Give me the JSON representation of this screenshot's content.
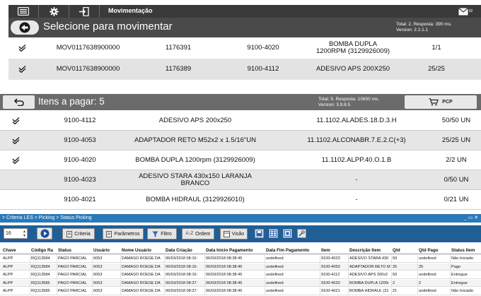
{
  "mov_screen": {
    "topbar": {
      "menu_icon": "hamburger-icon",
      "settings_icon": "gear-icon",
      "exit_icon": "exit-icon",
      "title": "Movimentação",
      "mail_icon": "envelope-icon",
      "mail_badge": "92"
    },
    "header": {
      "title": "Selecione para movimentar",
      "info_line1": "Total: 2. Resposta: 390 ms.",
      "info_line2": "Version: 2.2.1.1"
    },
    "rows": [
      {
        "mov": "MOV0117638900000",
        "code": "1176391",
        "ref": "9100-4020",
        "desc": "BOMBA DUPLA 1200RPM (3129926009)",
        "qty": "1/1"
      },
      {
        "mov": "MOV0117638900000",
        "code": "1176389",
        "ref": "9100-4112",
        "desc": "ADESIVO APS 200X250",
        "qty": "25/25"
      }
    ]
  },
  "pay_screen": {
    "header": {
      "title": "Itens a pagar: 5",
      "info_line1": "Total: 5. Resposta: 10650 ms.",
      "info_line2": "Version: 3.9.8.5",
      "pcp_label": "PCP"
    },
    "rows": [
      {
        "checked": true,
        "ref": "9100-4112",
        "desc": "ADESIVO APS 200x250",
        "loc": "11.1102.ALADES.18.D.3.H",
        "qty": "50/50 UN"
      },
      {
        "checked": true,
        "ref": "9100-4053",
        "desc": "ADAPTADOR RETO M52x2 x 1.5/16\"UN",
        "loc": "11.1102.ALCONABR.7.E.2.C(+3)",
        "qty": "25/25 UN"
      },
      {
        "checked": true,
        "ref": "9100-4020",
        "desc": "BOMBA DUPLA 1200rpm (3129926009)",
        "loc": "11.1102.ALPP.40.O.1.B",
        "qty": "2/2 UN"
      },
      {
        "checked": false,
        "ref": "9100-4023",
        "desc": "ADESIVO STARA 430x150 LARANJA BRANCO",
        "loc": "-",
        "qty": "0/50 UN"
      },
      {
        "checked": false,
        "ref": "9100-4021",
        "desc": "BOMBA HIDRAUL (3129926010)",
        "loc": "-",
        "qty": "0/21 UN"
      }
    ]
  },
  "status_picking": {
    "breadcrumb": "> Criteria LES > Picking > Status Picking",
    "window_controls": "_ ▭ ✕",
    "page_size": "16",
    "tools": {
      "criteria": "Criteria",
      "parametros": "Parâmetros",
      "filtro": "Filtro",
      "ordem": "Ordem",
      "visao": "Visão"
    },
    "columns": [
      "Chave",
      "Código Ra",
      "Status",
      "Usuário",
      "Nome Usuário",
      "Data Criação",
      "Data Início Pagamento",
      "Data Fim Pagamento",
      "Item",
      "Descrição Item",
      "Qtd",
      "Qtd Pago",
      "Status Item"
    ],
    "rows": [
      [
        "ALPP",
        "RQ113584",
        "PAGO PARCIAL",
        "6053",
        "DAMASO ROESE DA",
        "06/03/2018 08:16:",
        "06/03/2018 08:38:45",
        "undefined",
        "9100-4023",
        "ADESIVO STARA 430",
        "50",
        "undefined",
        "Não Iniciado"
      ],
      [
        "ALPP",
        "RQ113584",
        "PAGO PARCIAL",
        "6053",
        "DAMASO ROESE DA",
        "06/03/2018 08:16:",
        "06/03/2018 08:38:45",
        "undefined",
        "9100-4053",
        "ADAPTADOR RETO M",
        "25",
        "25",
        "Pago"
      ],
      [
        "ALPP",
        "RQ113584",
        "PAGO PARCIAL",
        "6053",
        "DAMASO ROESE DA",
        "06/03/2018 08:16:",
        "06/03/2018 08:38:45",
        "undefined",
        "9100-4112",
        "ADESIVO APS 200x2",
        "50",
        "undefined",
        "Entregue"
      ],
      [
        "ALPP",
        "RQ113585",
        "PAGO PARCIAL",
        "6053",
        "DAMASO ROESE DA",
        "06/03/2018 08:37:",
        "06/03/2018 08:38:45",
        "undefined",
        "9100-4020",
        "BOMBA DUPLA 1200r",
        "2",
        "2",
        "Entregue"
      ],
      [
        "ALPP",
        "RQ113585",
        "PAGO PARCIAL",
        "6053",
        "DAMASO ROESE DA",
        "06/03/2018 08:37:",
        "06/03/2018 08:38:45",
        "undefined",
        "9100-4021",
        "BOMBA HIDRAUL (31",
        "21",
        "undefined",
        "Não Iniciado"
      ]
    ]
  }
}
